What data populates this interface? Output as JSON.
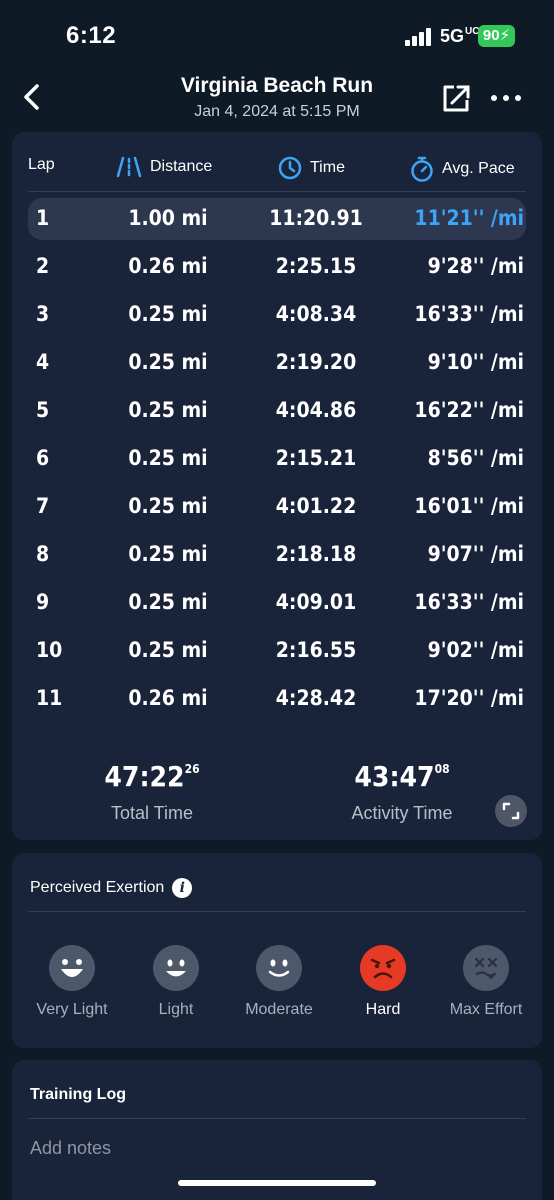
{
  "status": {
    "time": "6:12",
    "network": "5G",
    "network_sub": "UC",
    "battery": "90"
  },
  "nav": {
    "title": "Virginia Beach Run",
    "subtitle": "Jan 4, 2024 at 5:15 PM"
  },
  "laps": {
    "headers": {
      "lap": "Lap",
      "distance": "Distance",
      "time": "Time",
      "pace": "Avg. Pace"
    },
    "rows": [
      {
        "lap": "1",
        "distance": "1.00 mi",
        "time": "11:20.91",
        "pace": "11'21'' /mi"
      },
      {
        "lap": "2",
        "distance": "0.26 mi",
        "time": "2:25.15",
        "pace": "9'28'' /mi"
      },
      {
        "lap": "3",
        "distance": "0.25 mi",
        "time": "4:08.34",
        "pace": "16'33'' /mi"
      },
      {
        "lap": "4",
        "distance": "0.25 mi",
        "time": "2:19.20",
        "pace": "9'10'' /mi"
      },
      {
        "lap": "5",
        "distance": "0.25 mi",
        "time": "4:04.86",
        "pace": "16'22'' /mi"
      },
      {
        "lap": "6",
        "distance": "0.25 mi",
        "time": "2:15.21",
        "pace": "8'56'' /mi"
      },
      {
        "lap": "7",
        "distance": "0.25 mi",
        "time": "4:01.22",
        "pace": "16'01'' /mi"
      },
      {
        "lap": "8",
        "distance": "0.25 mi",
        "time": "2:18.18",
        "pace": "9'07'' /mi"
      },
      {
        "lap": "9",
        "distance": "0.25 mi",
        "time": "4:09.01",
        "pace": "16'33'' /mi"
      },
      {
        "lap": "10",
        "distance": "0.25 mi",
        "time": "2:16.55",
        "pace": "9'02'' /mi"
      },
      {
        "lap": "11",
        "distance": "0.26 mi",
        "time": "4:28.42",
        "pace": "17'20'' /mi"
      }
    ],
    "total_time": {
      "main": "47:22",
      "sup": "26",
      "label": "Total Time"
    },
    "activity_time": {
      "main": "43:47",
      "sup": "08",
      "label": "Activity Time"
    }
  },
  "exertion": {
    "title": "Perceived Exertion",
    "options": [
      {
        "label": "Very Light",
        "selected": false
      },
      {
        "label": "Light",
        "selected": false
      },
      {
        "label": "Moderate",
        "selected": false
      },
      {
        "label": "Hard",
        "selected": true
      },
      {
        "label": "Max Effort",
        "selected": false
      }
    ]
  },
  "log": {
    "title": "Training Log",
    "placeholder": "Add notes"
  },
  "colors": {
    "accent": "#3ea5f5",
    "hard": "#e53a24",
    "card": "#19233a",
    "background": "#0f1a27"
  }
}
